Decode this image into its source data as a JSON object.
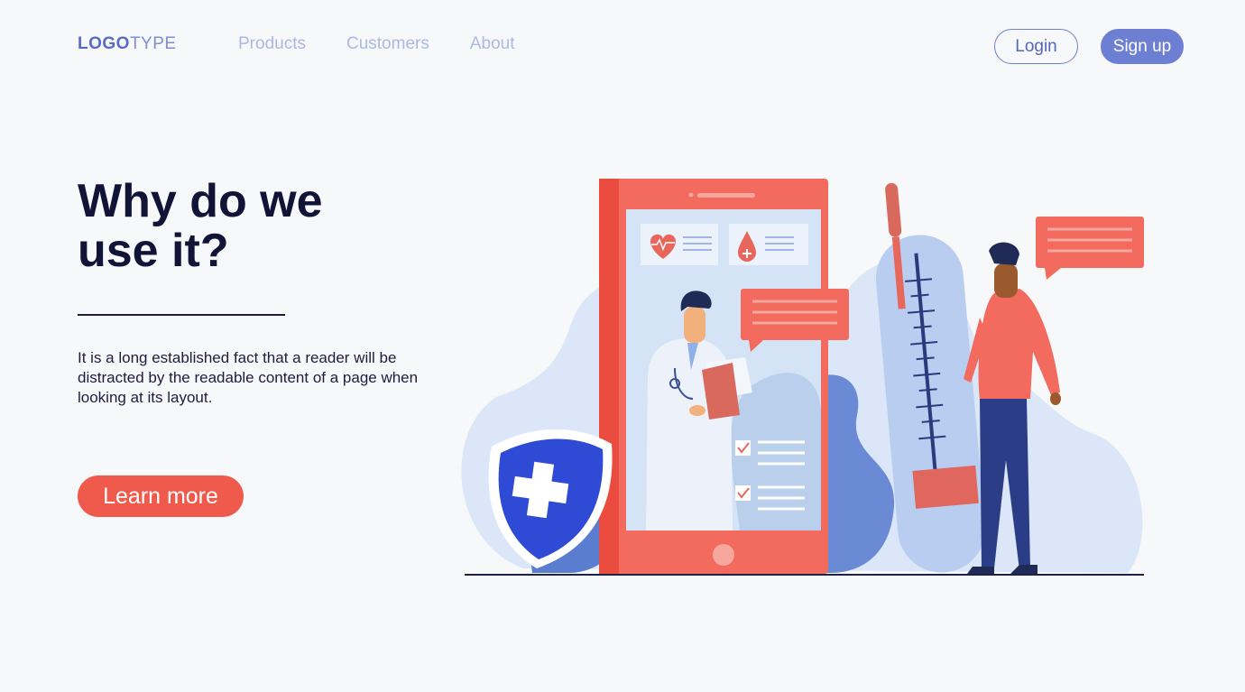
{
  "nav": {
    "logo_bold": "LOGO",
    "logo_light": "TYPE",
    "links": [
      "Products",
      "Customers",
      "About"
    ],
    "login_label": "Login",
    "signup_label": "Sign up"
  },
  "hero": {
    "title_line1": "Why do we",
    "title_line2": "use it?",
    "paragraph": "It is a long established fact that a reader will be distracted by the readable content of a page when looking at its layout.",
    "cta_label": "Learn more"
  },
  "colors": {
    "accent_coral": "#f05a4d",
    "accent_indigo": "#6c7fd3",
    "nav_link": "#aab8e6",
    "title": "#111337"
  },
  "icons": [
    "heart-icon",
    "blood-drop-icon",
    "shield-cross-icon",
    "checkbox-icon",
    "thermometer-icon"
  ]
}
